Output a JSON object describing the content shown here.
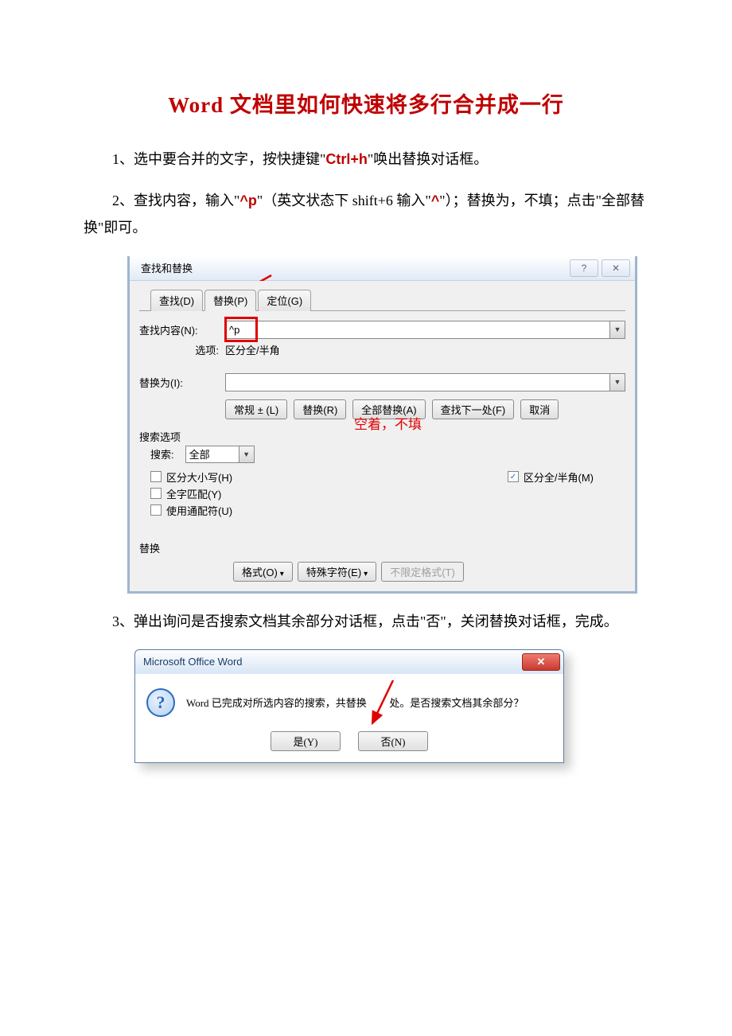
{
  "title": "Word 文档里如何快速将多行合并成一行",
  "para1": {
    "lead": "1、选中要合并的文字，按快捷键\"",
    "hotkey": "Ctrl+h",
    "tail": "\"唤出替换对话框。"
  },
  "para2": {
    "lead": "2、查找内容，输入\"",
    "code": "^p",
    "mid": "\"（英文状态下 shift+6 输入\"",
    "caret": "^",
    "tail": "\"）；替换为，不填；点击\"全部替换\"即可。"
  },
  "dlg1": {
    "title": "查找和替换",
    "tabs": {
      "find": "查找(D)",
      "replace": "替换(P)",
      "goto": "定位(G)"
    },
    "find_label": "查找内容(N):",
    "find_value": "^p",
    "options_label": "选项:",
    "options_value": "区分全/半角",
    "replace_label": "替换为(I):",
    "annotation": "空着，不填",
    "buttons": {
      "normal": "常规 ± (L)",
      "replace": "替换(R)",
      "replace_all": "全部替换(A)",
      "find_next": "查找下一处(F)",
      "cancel": "取消"
    },
    "search_options_label": "搜索选项",
    "search_label": "搜索:",
    "search_scope": "全部",
    "chk_case": "区分大小写(H)",
    "chk_whole": "全字匹配(Y)",
    "chk_wildcard": "使用通配符(U)",
    "chk_fullhalf": "区分全/半角(M)",
    "replace_section": "替换",
    "fmt": "格式(O)",
    "special": "特殊字符(E)",
    "nofmt": "不限定格式(T)"
  },
  "para3": "3、弹出询问是否搜索文档其余部分对话框，点击\"否\"，关闭替换对话框，完成。",
  "dlg2": {
    "title": "Microsoft Office Word",
    "msg_before": "Word 已完成对所选内容的搜索，共替换",
    "msg_after": "处。是否搜索文档其余部分？",
    "yes": "是(Y)",
    "no": "否(N)"
  }
}
